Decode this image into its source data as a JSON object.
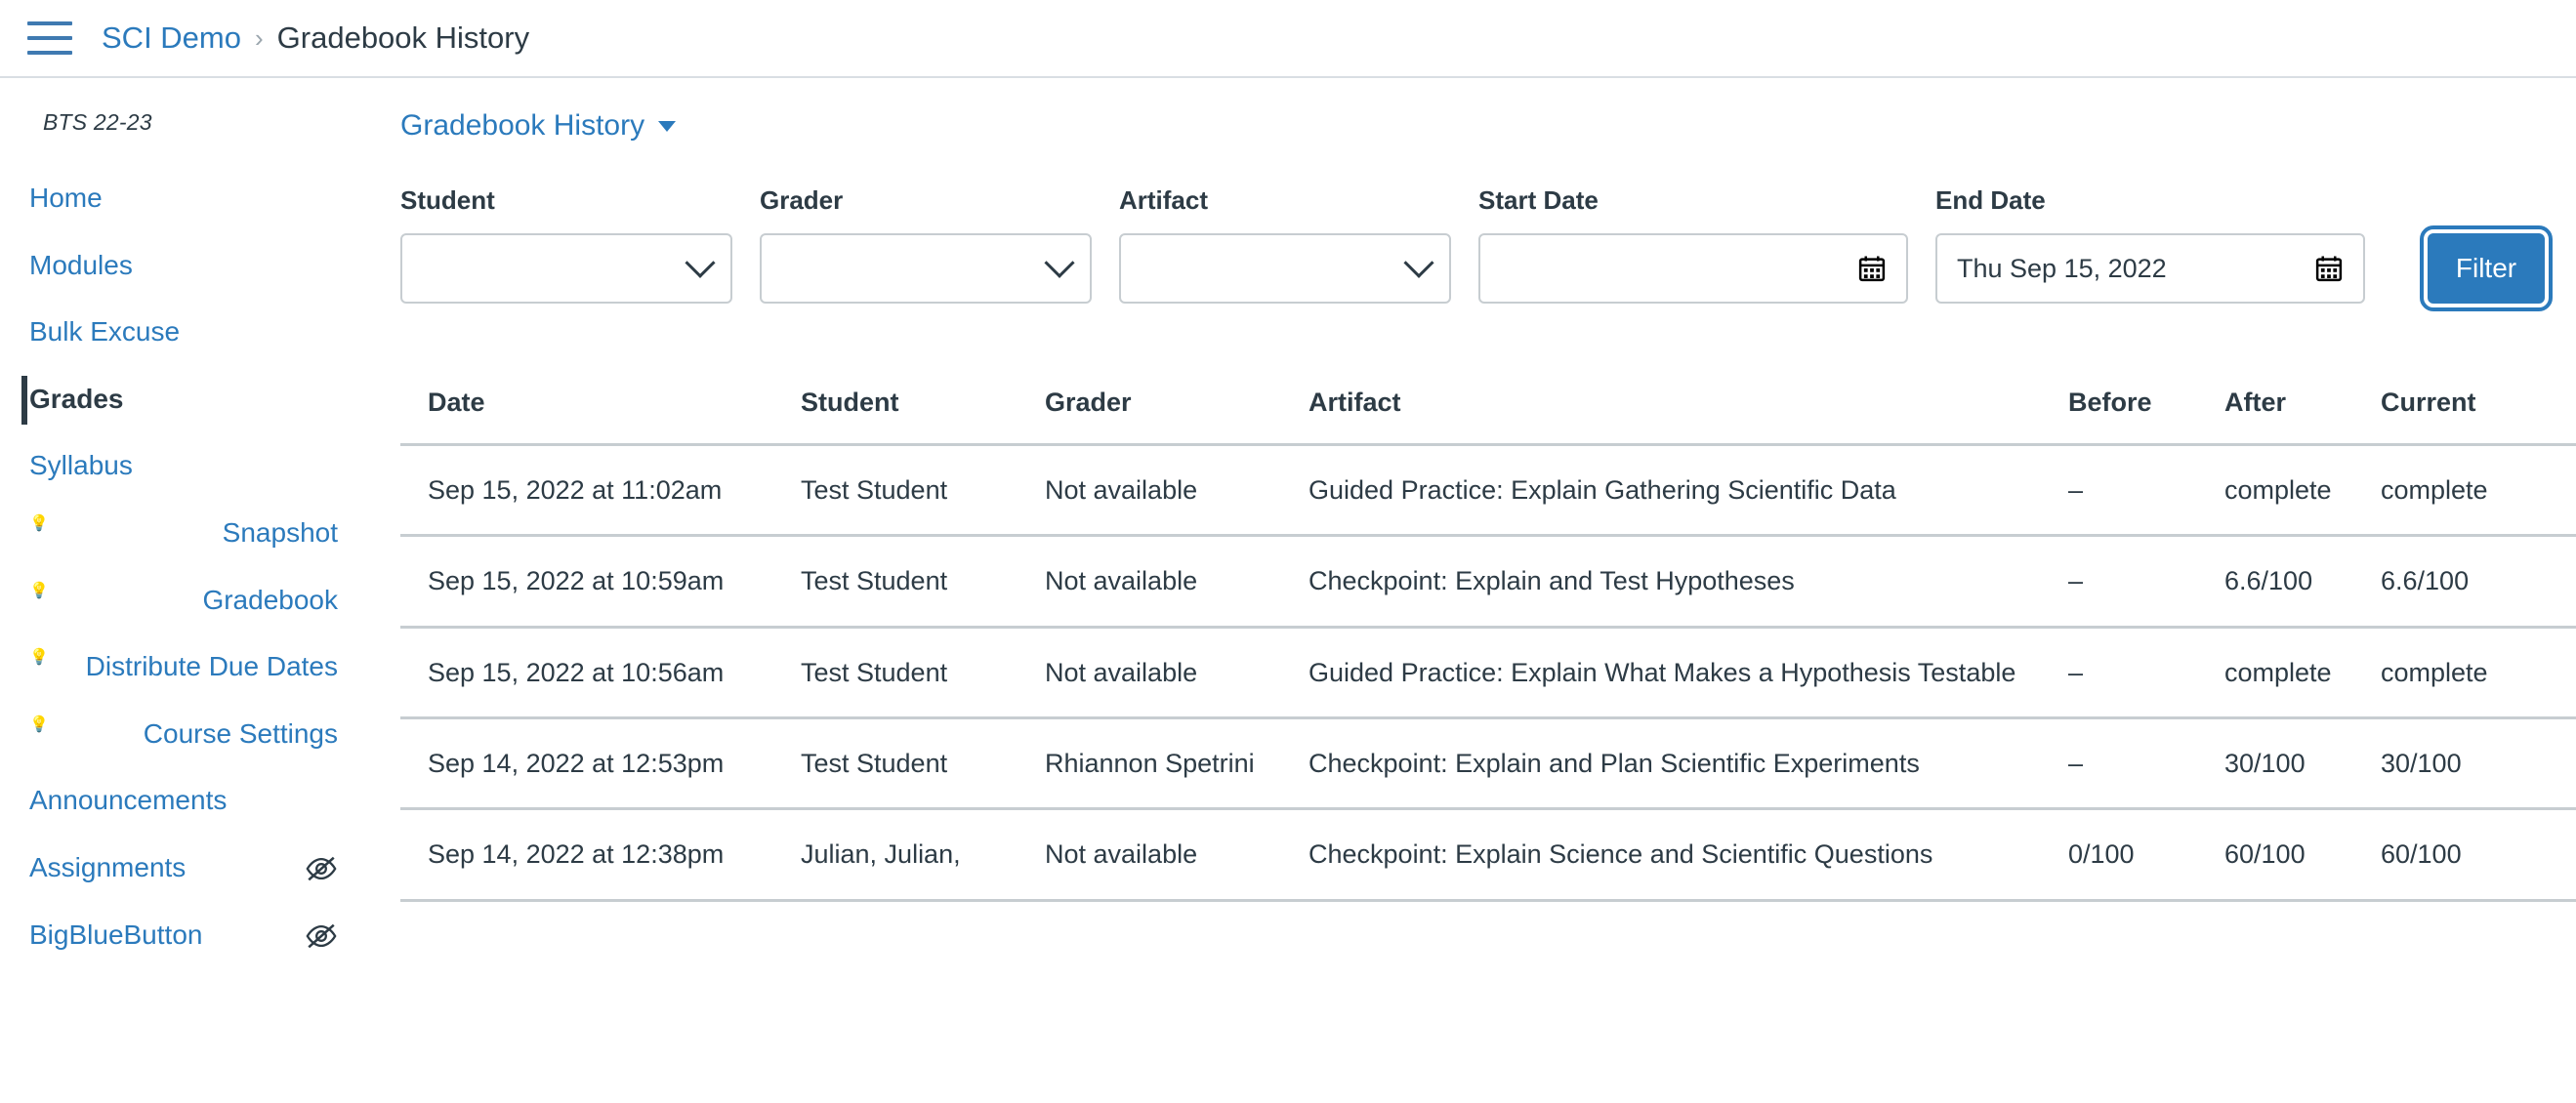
{
  "topbar": {
    "menu_icon": "hamburger-icon",
    "breadcrumb": {
      "course": "SCI Demo",
      "separator": "›",
      "current": "Gradebook History"
    }
  },
  "sidebar": {
    "course_code": "BTS 22-23",
    "items": [
      {
        "label": "Home",
        "active": false,
        "bulb": false,
        "hidden_icon": false
      },
      {
        "label": "Modules",
        "active": false,
        "bulb": false,
        "hidden_icon": false
      },
      {
        "label": "Bulk Excuse",
        "active": false,
        "bulb": false,
        "hidden_icon": false
      },
      {
        "label": "Grades",
        "active": true,
        "bulb": false,
        "hidden_icon": false
      },
      {
        "label": "Syllabus",
        "active": false,
        "bulb": false,
        "hidden_icon": false
      },
      {
        "label": "Snapshot",
        "active": false,
        "bulb": true,
        "hidden_icon": false
      },
      {
        "label": "Gradebook",
        "active": false,
        "bulb": true,
        "hidden_icon": false
      },
      {
        "label": "Distribute Due Dates",
        "active": false,
        "bulb": true,
        "hidden_icon": false
      },
      {
        "label": "Course Settings",
        "active": false,
        "bulb": true,
        "hidden_icon": false
      },
      {
        "label": "Announcements",
        "active": false,
        "bulb": false,
        "hidden_icon": false
      },
      {
        "label": "Assignments",
        "active": false,
        "bulb": false,
        "hidden_icon": true
      },
      {
        "label": "BigBlueButton",
        "active": false,
        "bulb": false,
        "hidden_icon": true
      }
    ]
  },
  "main": {
    "view_switcher_label": "Gradebook History",
    "filters": {
      "student": {
        "label": "Student",
        "value": "",
        "placeholder": ""
      },
      "grader": {
        "label": "Grader",
        "value": "",
        "placeholder": ""
      },
      "artifact": {
        "label": "Artifact",
        "value": "",
        "placeholder": ""
      },
      "start_date": {
        "label": "Start Date",
        "value": "",
        "placeholder": ""
      },
      "end_date": {
        "label": "End Date",
        "value": "Thu Sep 15, 2022",
        "placeholder": ""
      },
      "filter_button": "Filter"
    },
    "table": {
      "columns": [
        "Date",
        "Student",
        "Grader",
        "Artifact",
        "Before",
        "After",
        "Current"
      ],
      "rows": [
        {
          "date": "Sep 15, 2022 at 11:02am",
          "student": "Test Student",
          "grader": "Not available",
          "artifact": "Guided Practice: Explain Gathering Scientific Data",
          "before": "–",
          "after": "complete",
          "current": "complete"
        },
        {
          "date": "Sep 15, 2022 at 10:59am",
          "student": "Test Student",
          "grader": "Not available",
          "artifact": "Checkpoint: Explain and Test Hypotheses",
          "before": "–",
          "after": "6.6/100",
          "current": "6.6/100"
        },
        {
          "date": "Sep 15, 2022 at 10:56am",
          "student": "Test Student",
          "grader": "Not available",
          "artifact": "Guided Practice: Explain What Makes a Hypothesis Testable",
          "before": "–",
          "after": "complete",
          "current": "complete"
        },
        {
          "date": "Sep 14, 2022 at 12:53pm",
          "student": "Test Student",
          "grader": "Rhiannon Spetrini",
          "artifact": "Checkpoint: Explain and Plan Scientific Experiments",
          "before": "–",
          "after": "30/100",
          "current": "30/100"
        },
        {
          "date": "Sep 14, 2022 at 12:38pm",
          "student": "Julian, Julian,",
          "grader": "Not available",
          "artifact": "Checkpoint: Explain Science and Scientific Questions",
          "before": "0/100",
          "after": "60/100",
          "current": "60/100"
        }
      ]
    }
  },
  "colors": {
    "link": "#2B7ABC",
    "text": "#2D3B45",
    "border": "#C7CDD1",
    "accent": "#2B7ABC"
  }
}
